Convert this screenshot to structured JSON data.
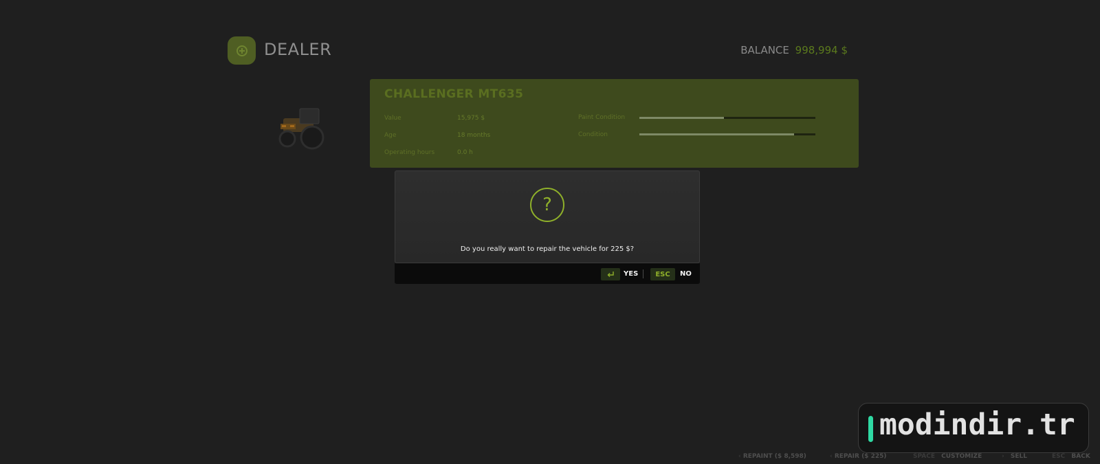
{
  "header": {
    "title": "DEALER",
    "balance_label": "BALANCE",
    "balance_value": "998,994 $"
  },
  "vehicle": {
    "name": "CHALLENGER MT635",
    "specs": [
      {
        "label": "Value",
        "value": "15,975 $"
      },
      {
        "label": "Age",
        "value": "18 months"
      },
      {
        "label": "Operating hours",
        "value": "0.0 h"
      }
    ],
    "bars": [
      {
        "label": "Paint Condition",
        "fill": 0.48
      },
      {
        "label": "Condition",
        "fill": 0.88
      }
    ]
  },
  "dialog": {
    "icon_glyph": "?",
    "message": "Do you really want to repair the vehicle for 225 $?",
    "yes_label": "YES",
    "esc_key": "ESC",
    "no_label": "NO"
  },
  "hints": [
    {
      "label": "REPAINT ($ 8,598)"
    },
    {
      "label": "REPAIR ($ 225)"
    },
    {
      "key": "SPACE",
      "label": "CUSTOMIZE"
    },
    {
      "label": "SELL"
    },
    {
      "key": "ESC",
      "label": "BACK"
    }
  ],
  "watermark": {
    "text": "modindir.tr"
  },
  "colors": {
    "accent": "#8fb02a",
    "panel": "#3e4a1d",
    "watermark_bar": "#2fd9a3"
  }
}
